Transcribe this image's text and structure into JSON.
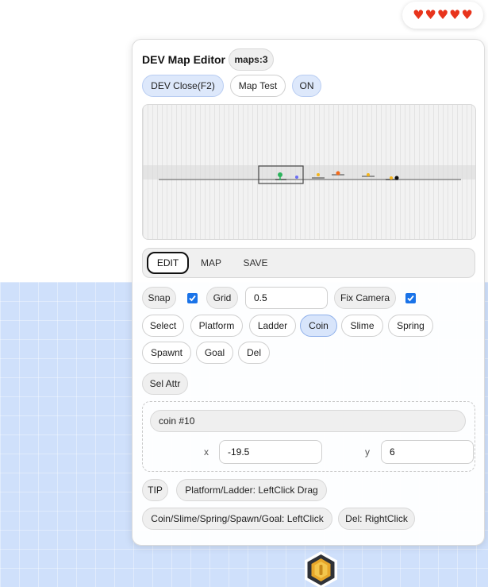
{
  "hud": {
    "hearts": [
      "♥",
      "♥",
      "♥",
      "♥",
      "♥"
    ],
    "heart_color": "#e8341c"
  },
  "editor": {
    "title": "DEV Map Editor",
    "maps_badge": "maps:3",
    "dev_close_label": "DEV Close(F2)",
    "map_test_label": "Map Test",
    "on_label": "ON",
    "tabs": [
      "EDIT",
      "MAP",
      "SAVE"
    ],
    "active_tab": "EDIT",
    "snap_label": "Snap",
    "snap_checked": true,
    "grid_label": "Grid",
    "grid_value": "0.5",
    "fix_camera_label": "Fix Camera",
    "fix_camera_checked": true,
    "tools": [
      "Select",
      "Platform",
      "Ladder",
      "Coin",
      "Slime",
      "Spring",
      "Spawnt",
      "Goal",
      "Del"
    ],
    "active_tool": "Coin",
    "sel_attr_label": "Sel Attr",
    "selected_name": "coin #10",
    "x_label": "x",
    "x_value": "-19.5",
    "y_label": "y",
    "y_value": "6",
    "tip_label": "TIP",
    "tips": [
      "Platform/Ladder: LeftClick Drag",
      "Coin/Slime/Spring/Spawn/Goal: LeftClick",
      "Del: RightClick"
    ]
  },
  "colors": {
    "accent": "#1a73e8",
    "active_tool_bg": "#d8e5fb",
    "background_blue": "#cfe0fb"
  }
}
